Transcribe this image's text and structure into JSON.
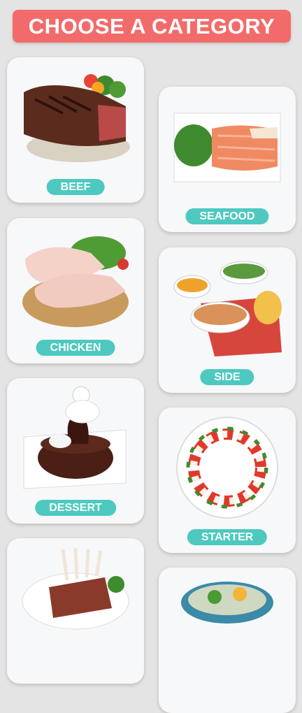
{
  "header": {
    "title": "CHOOSE A CATEGORY"
  },
  "categories": [
    {
      "label": "BEEF"
    },
    {
      "label": "SEAFOOD"
    },
    {
      "label": "CHICKEN"
    },
    {
      "label": "SIDE"
    },
    {
      "label": "DESSERT"
    },
    {
      "label": "STARTER"
    },
    {
      "label": ""
    },
    {
      "label": ""
    }
  ],
  "colors": {
    "background": "#e4e4e4",
    "header": "#f26b6b",
    "pill": "#4ec9c0",
    "card": "#f7f8fa"
  }
}
